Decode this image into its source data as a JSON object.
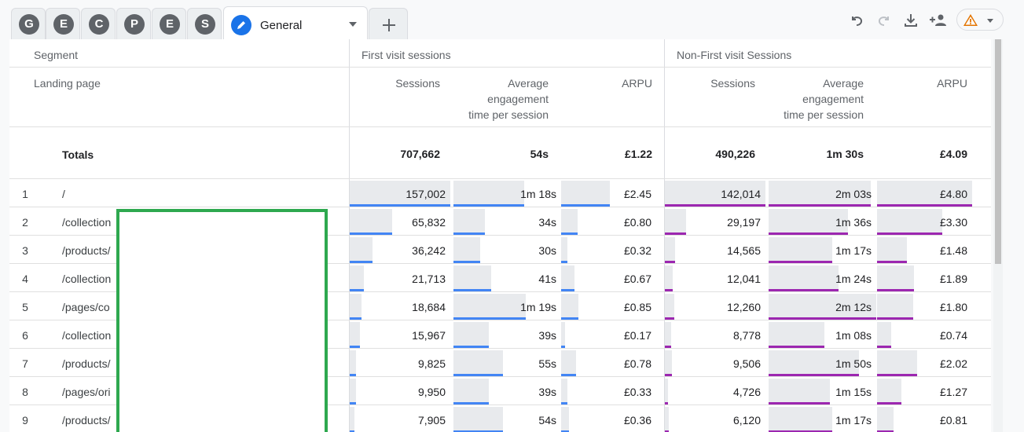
{
  "tabs": {
    "segments": [
      {
        "letter": "G"
      },
      {
        "letter": "E"
      },
      {
        "letter": "C"
      },
      {
        "letter": "P"
      },
      {
        "letter": "E"
      },
      {
        "letter": "S"
      }
    ],
    "active_label": "General",
    "add_label": "+"
  },
  "table": {
    "segment_header": "Segment",
    "dimension_header": "Landing page",
    "group1": "First visit sessions",
    "group2": "Non-First visit Sessions",
    "metrics": {
      "sessions": "Sessions",
      "avg_line1": "Average",
      "avg_line2": "engagement",
      "avg_line3": "time per session",
      "arpu": "ARPU"
    },
    "totals": {
      "label": "Totals",
      "fv_sessions": "707,662",
      "fv_avg": "54s",
      "fv_arpu": "£1.22",
      "nfv_sessions": "490,226",
      "nfv_avg": "1m 30s",
      "nfv_arpu": "£4.09"
    },
    "rows": [
      {
        "num": "1",
        "page": "/",
        "c": [
          "157,002",
          "1m 18s",
          "£2.45",
          "142,014",
          "2m 03s",
          "£4.80"
        ],
        "f": [
          1.0,
          0.66,
          0.51,
          1.0,
          0.95,
          1.0
        ]
      },
      {
        "num": "2",
        "page": "/collection",
        "c": [
          "65,832",
          "34s",
          "£0.80",
          "29,197",
          "1m 36s",
          "£3.30"
        ],
        "f": [
          0.42,
          0.29,
          0.17,
          0.21,
          0.74,
          0.69
        ]
      },
      {
        "num": "3",
        "page": "/products/",
        "c": [
          "36,242",
          "30s",
          "£0.32",
          "14,565",
          "1m 17s",
          "£1.48"
        ],
        "f": [
          0.23,
          0.25,
          0.07,
          0.1,
          0.59,
          0.31
        ]
      },
      {
        "num": "4",
        "page": "/collection",
        "c": [
          "21,713",
          "41s",
          "£0.67",
          "12,041",
          "1m 24s",
          "£1.89"
        ],
        "f": [
          0.14,
          0.35,
          0.14,
          0.08,
          0.65,
          0.39
        ]
      },
      {
        "num": "5",
        "page": "/pages/co",
        "c": [
          "18,684",
          "1m 19s",
          "£0.85",
          "12,260",
          "2m 12s",
          "£1.80"
        ],
        "f": [
          0.12,
          0.67,
          0.18,
          0.09,
          1.0,
          0.38
        ]
      },
      {
        "num": "6",
        "page": "/collection",
        "c": [
          "15,967",
          "39s",
          "£0.17",
          "8,778",
          "1m 08s",
          "£0.74"
        ],
        "f": [
          0.1,
          0.33,
          0.04,
          0.06,
          0.52,
          0.15
        ]
      },
      {
        "num": "7",
        "page": "/products/",
        "c": [
          "9,825",
          "55s",
          "£0.78",
          "9,506",
          "1m 50s",
          "£2.02"
        ],
        "f": [
          0.06,
          0.46,
          0.16,
          0.07,
          0.84,
          0.42
        ]
      },
      {
        "num": "8",
        "page": "/pages/ori",
        "c": [
          "9,950",
          "39s",
          "£0.33",
          "4,726",
          "1m 15s",
          "£1.27"
        ],
        "f": [
          0.06,
          0.33,
          0.07,
          0.03,
          0.57,
          0.26
        ]
      },
      {
        "num": "9",
        "page": "/products/",
        "c": [
          "7,905",
          "54s",
          "£0.36",
          "6,120",
          "1m 17s",
          "£0.81"
        ],
        "f": [
          0.05,
          0.46,
          0.08,
          0.04,
          0.59,
          0.17
        ]
      }
    ]
  },
  "colors": {
    "first_visit_bar": "#4285f4",
    "non_first_visit_bar": "#9c27b0",
    "bar_bg": "#e8eaed",
    "accent": "#1a73e8",
    "warning": "#e37400",
    "overlay_border": "#2ea84f"
  },
  "toolbar_icons": [
    "undo-icon",
    "redo-icon",
    "download-icon",
    "share-icon",
    "warning-icon"
  ]
}
